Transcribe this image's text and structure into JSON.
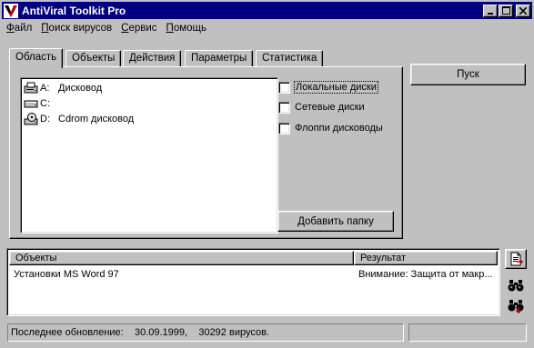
{
  "window": {
    "title": "AntiViral Toolkit Pro",
    "controls": [
      "minimize",
      "maximize",
      "close"
    ]
  },
  "menu": {
    "items": [
      "Файл",
      "Поиск вирусов",
      "Сервис",
      "Помощь"
    ],
    "mnemonics": [
      "Ф",
      "П",
      "С",
      "П"
    ]
  },
  "tabs": {
    "items": [
      "Область",
      "Объекты",
      "Действия",
      "Параметры",
      "Статистика"
    ],
    "active": "Область"
  },
  "drives": [
    {
      "letter": "A:",
      "label": "Дисковод",
      "icon": "floppy-drive-icon"
    },
    {
      "letter": "C:",
      "label": "",
      "icon": "hard-drive-icon"
    },
    {
      "letter": "D:",
      "label": "Cdrom дисковод",
      "icon": "cdrom-drive-icon"
    }
  ],
  "options": [
    {
      "label": "Локальные диски",
      "checked": false
    },
    {
      "label": "Сетевые диски",
      "checked": false
    },
    {
      "label": "Флоппи дисководы",
      "checked": false
    }
  ],
  "buttons": {
    "add_folder": "Добавить папку",
    "scan": "Пуск"
  },
  "results": {
    "columns": [
      "Объекты",
      "Результат"
    ],
    "rows": [
      {
        "object": "Установки MS Word 97",
        "result": "Внимание: Защита от макр..."
      }
    ]
  },
  "side_tools": [
    "report-icon",
    "find-icon",
    "find-next-icon"
  ],
  "status": {
    "label": "Последнее обновление:",
    "date": "30.09.1999,",
    "count": "30292 вирусов.",
    "right": ""
  },
  "colors": {
    "face": "#c0c0c0",
    "titlebar": "#000080",
    "window": "#ffffff"
  }
}
